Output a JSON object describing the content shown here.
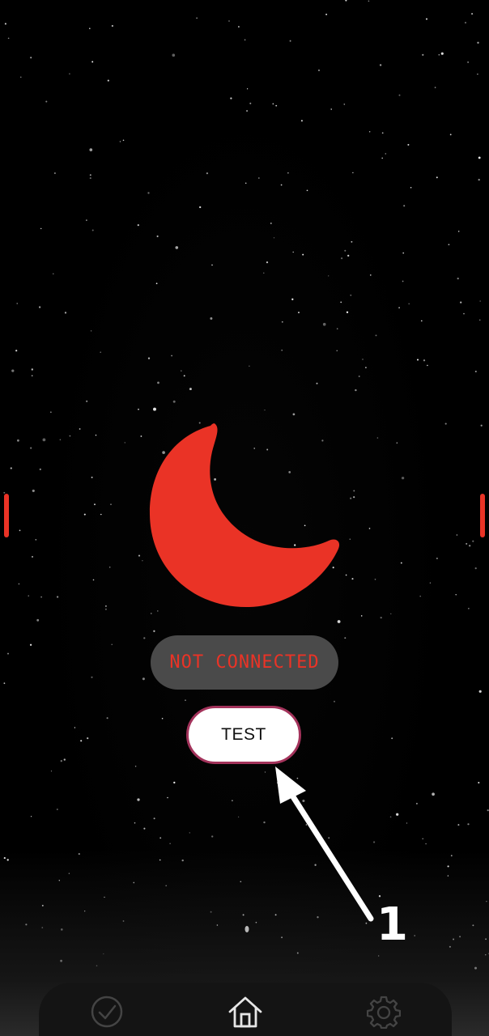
{
  "status": {
    "text": "NOT CONNECTED",
    "color": "#ea3326"
  },
  "test_button": {
    "label": "TEST",
    "border_color": "#a3335b"
  },
  "annotation": {
    "step_number": "1"
  },
  "moon_icon": {
    "name": "crescent-moon-icon",
    "color": "#ea3326"
  },
  "bottom_nav": {
    "items": [
      {
        "icon": "check-circle-icon",
        "active": false
      },
      {
        "icon": "home-icon",
        "active": true
      },
      {
        "icon": "gear-icon",
        "active": false
      }
    ]
  },
  "colors": {
    "accent": "#ea3326",
    "background": "#000000",
    "pill_background": "#4a4a4a"
  }
}
